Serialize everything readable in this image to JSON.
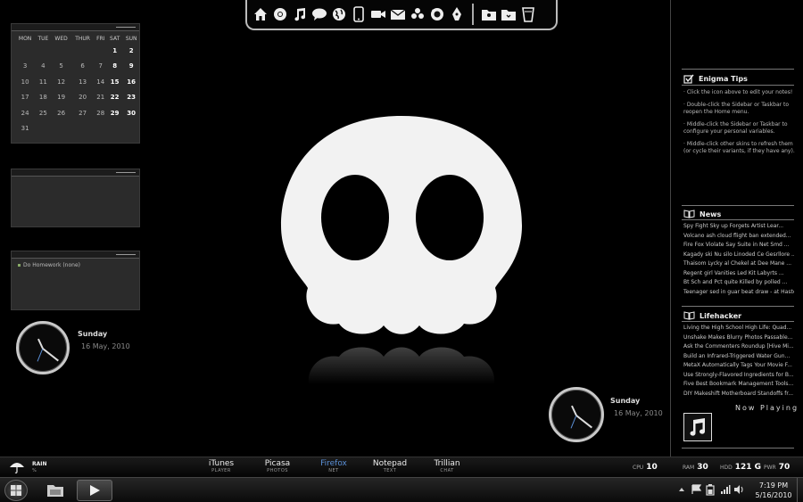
{
  "launcher": {
    "left_icons": [
      "home-icon",
      "chrome-icon",
      "music-note-icon",
      "chat-bubble-icon",
      "globe-icon",
      "phone-icon",
      "camera-icon",
      "mail-icon",
      "flower-icon",
      "firefox-icon",
      "pen-icon"
    ],
    "right_icons": [
      "user-folder-icon",
      "folder-icon",
      "recycle-bin-icon"
    ]
  },
  "calendar": {
    "headers": [
      "MON",
      "TUE",
      "WED",
      "THUR",
      "FRI",
      "SAT",
      "SUN"
    ],
    "weeks": [
      [
        "",
        "",
        "",
        "",
        "",
        "1",
        "2"
      ],
      [
        "3",
        "4",
        "5",
        "6",
        "7",
        "8",
        "9"
      ],
      [
        "10",
        "11",
        "12",
        "13",
        "14",
        "15",
        "16"
      ],
      [
        "17",
        "18",
        "19",
        "20",
        "21",
        "22",
        "23"
      ],
      [
        "24",
        "25",
        "26",
        "27",
        "28",
        "29",
        "30"
      ],
      [
        "31",
        "",
        "",
        "",
        "",
        "",
        ""
      ]
    ]
  },
  "todo": {
    "item": "Do Homework (none)"
  },
  "clock_left": {
    "day": "Sunday",
    "date": "16 May, 2010"
  },
  "clock_right": {
    "day": "Sunday",
    "date": "16 May, 2010"
  },
  "sidebar": {
    "tips": {
      "title": "Enigma Tips",
      "items": [
        "· Click the icon above to edit your notes!",
        "· Double-click the Sidebar or Taskbar to reopen the Home menu.",
        "· Middle-click the Sidebar or Taskbar to configure your personal variables.",
        "· Middle-click other skins to refresh them (or cycle their variants, if they have any)."
      ]
    },
    "news": {
      "title": "News",
      "items": [
        "Spy Fight Sky up Forgets Artist Lear...",
        "Volcano ash cloud flight ban extended...",
        "Fire Fox Violate Say Suite in Net Smd ...",
        "Kagady ski Nu silo Linoded Ce Gesrllore ...",
        "Thaisom Lycky al Chekel at Dee Mane ...",
        "Regent girl Vanities Led Kit Labyrts ...",
        "Bt Sch and Pct quite Killed by polled ...",
        "Teenager sed in guar beat draw - at Haste ..."
      ]
    },
    "lifehacker": {
      "title": "Lifehacker",
      "items": [
        "Living the High School High Life: Quad...",
        "Unshake Makes Blurry Photos Passable...",
        "Ask the Commenters Roundup [Hive Mi...",
        "Build an Infrared-Triggered Water Gun...",
        "MetaX Automatically Tags Your Movie F...",
        "Use Strongly-Flavored Ingredients for B...",
        "Five Best Bookmark Management Tools...",
        "DIY Makeshift Motherboard Standoffs fr..."
      ]
    },
    "now_playing": "Now Playing"
  },
  "dock": {
    "weather": {
      "label": "RAIN",
      "unit": "%"
    },
    "apps": [
      {
        "name": "iTunes",
        "sub": "PLAYER"
      },
      {
        "name": "Picasa",
        "sub": "PHOTOS"
      },
      {
        "name": "Firefox",
        "sub": "NET"
      },
      {
        "name": "Notepad",
        "sub": "TEXT"
      },
      {
        "name": "Trillian",
        "sub": "CHAT"
      }
    ],
    "stats": {
      "cpu_label": "CPU",
      "cpu": "10",
      "ram_label": "RAM",
      "ram": "30",
      "hdd_label": "HDD",
      "hdd": "121 G",
      "pwr_label": "PWR",
      "pwr": "70"
    }
  },
  "taskbar": {
    "time": "7:19 PM",
    "date": "5/16/2010"
  },
  "colors": {
    "accent": "#5a8fd6",
    "skull": "#f2f2f2",
    "bg": "#000000"
  }
}
